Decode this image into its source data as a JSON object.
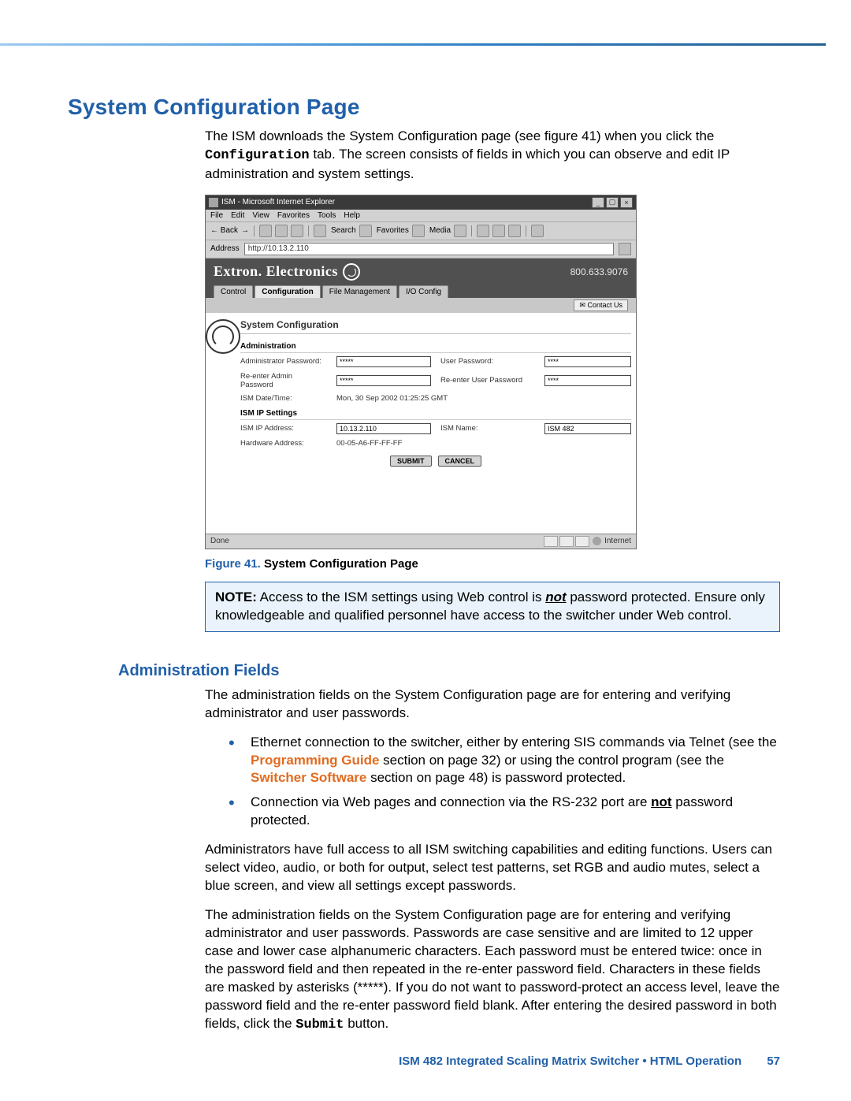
{
  "section_title": "System Configuration Page",
  "intro": {
    "part1": "The ISM downloads the System Configuration page (see figure 41) when you click the ",
    "config_tab": "Configuration",
    "part2": " tab.  The screen consists of fields in which you can observe and edit IP administration and system settings."
  },
  "ie": {
    "title": "ISM - Microsoft Internet Explorer",
    "win_min": "_",
    "win_max": "▢",
    "win_close": "×",
    "menu": {
      "file": "File",
      "edit": "Edit",
      "view": "View",
      "favorites": "Favorites",
      "tools": "Tools",
      "help": "Help"
    },
    "toolbar": {
      "back": "Back",
      "search": "Search",
      "favorites": "Favorites",
      "media": "Media"
    },
    "address_label": "Address",
    "address_value": "http://10.13.2.110",
    "brand": "Extron. Electronics",
    "phone": "800.633.9076",
    "tabs": {
      "control": "Control",
      "configuration": "Configuration",
      "file_mgmt": "File Management",
      "io_config": "I/O Config"
    },
    "contact": "Contact Us",
    "config_title": "System Configuration",
    "section_admin": "Administration",
    "section_ip": "ISM IP Settings",
    "labels": {
      "admin_pw": "Administrator Password:",
      "user_pw": "User Password:",
      "readmin_pw": "Re-enter Admin Password",
      "reuser_pw": "Re-enter User Password",
      "datetime": "ISM Date/Time:",
      "ip_addr": "ISM IP Address:",
      "ism_name": "ISM Name:",
      "hw_addr": "Hardware Address:"
    },
    "values": {
      "admin_pw": "*****",
      "user_pw": "****",
      "readmin_pw": "*****",
      "reuser_pw": "****",
      "datetime": "Mon, 30 Sep 2002 01:25:25 GMT",
      "ip_addr": "10.13.2.110",
      "ism_name": "ISM 482",
      "hw_addr": "00-05-A6-FF-FF-FF"
    },
    "buttons": {
      "submit": "SUBMIT",
      "cancel": "CANCEL"
    },
    "status_done": "Done",
    "status_zone": "Internet"
  },
  "figure": {
    "label": "Figure 41.",
    "title": "System Configuration Page"
  },
  "note": {
    "label": "NOTE:",
    "text_before": "   Access to the ISM settings using Web control is ",
    "not": "not",
    "text_after": " password protected.  Ensure only knowledgeable and qualified personnel have access to the switcher under Web control."
  },
  "admin_heading": "Administration Fields",
  "admin_intro": "The administration fields on the System Configuration page are for entering and verifying administrator and user passwords.",
  "bullets": {
    "b1_before": "Ethernet connection to the switcher, either by entering SIS commands via Telnet (see the ",
    "b1_link1": "Programming Guide",
    "b1_mid": " section on page 32) or using the control program (see the ",
    "b1_link2": "Switcher Software",
    "b1_after": " section on page 48) is password protected.",
    "b2_before": "Connection via Web pages and connection via the RS-232 port are ",
    "b2_not": "not",
    "b2_after": " password protected."
  },
  "admin_p2": "Administrators have full access to all ISM switching capabilities and editing functions.  Users can select video, audio, or both for output, select test patterns, set RGB and audio mutes, select a blue screen, and view all settings except passwords.",
  "admin_p3_before": "The administration fields on the System Configuration page are for entering and verifying administrator and user passwords.  Passwords are case sensitive and are limited to 12 upper case and lower case alphanumeric characters.  Each password must be entered twice: once in the password field and then repeated in the re-enter password field.  Characters in these fields are masked by asterisks (*****).  If you do not want to password-protect an access level, leave the password field and the re-enter password field blank.  After entering the desired password in both fields, click the ",
  "admin_p3_submit": "Submit",
  "admin_p3_after": " button.",
  "footer": {
    "title": "ISM 482 Integrated Scaling Matrix Switcher • HTML Operation",
    "page": "57"
  }
}
